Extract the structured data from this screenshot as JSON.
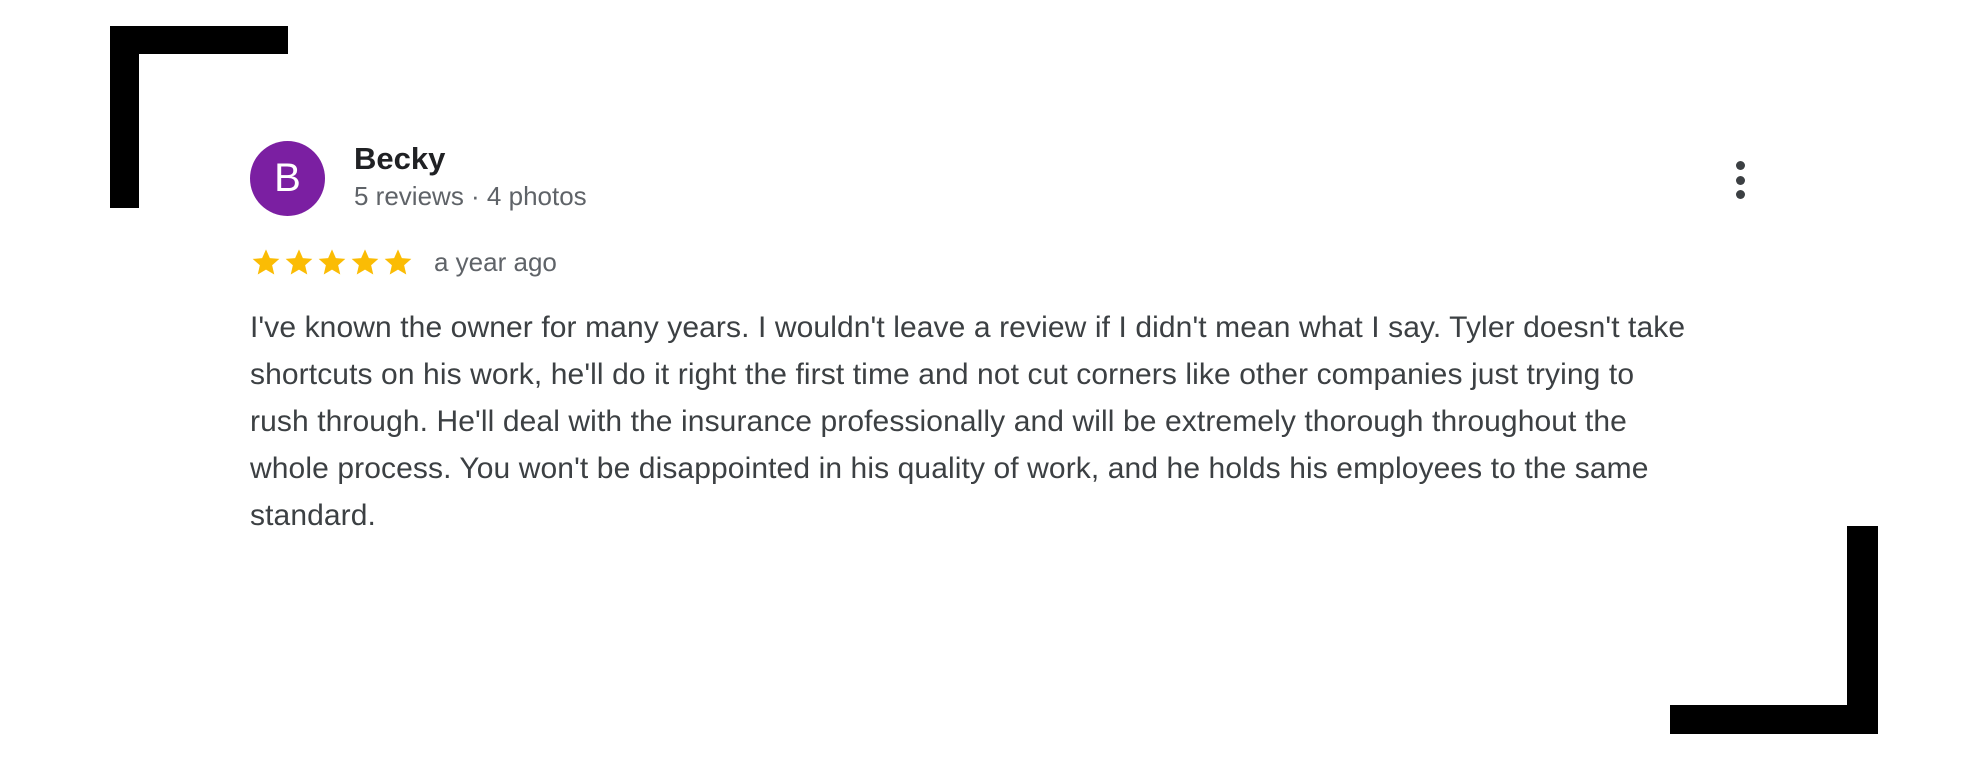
{
  "review": {
    "avatar_initial": "B",
    "author_name": "Becky",
    "author_meta": "5 reviews · 4 photos",
    "rating": 5,
    "rating_max": 5,
    "date": "a year ago",
    "text": "I've known the owner for many years. I wouldn't leave a review if I didn't mean what I say. Tyler doesn't take shortcuts on his work, he'll do it right the first time and not cut corners like other companies just trying to rush through. He'll deal with the insurance professionally and will be extremely thorough throughout the whole process. You won't be disappointed in his quality of work, and he holds his employees to the same standard."
  },
  "icons": {
    "star": "star-icon",
    "menu": "more-vert-icon"
  },
  "colors": {
    "avatar_bg": "#7b1fa2",
    "star": "#fbbc04",
    "text": "#3c4043",
    "meta": "#5f6368"
  }
}
